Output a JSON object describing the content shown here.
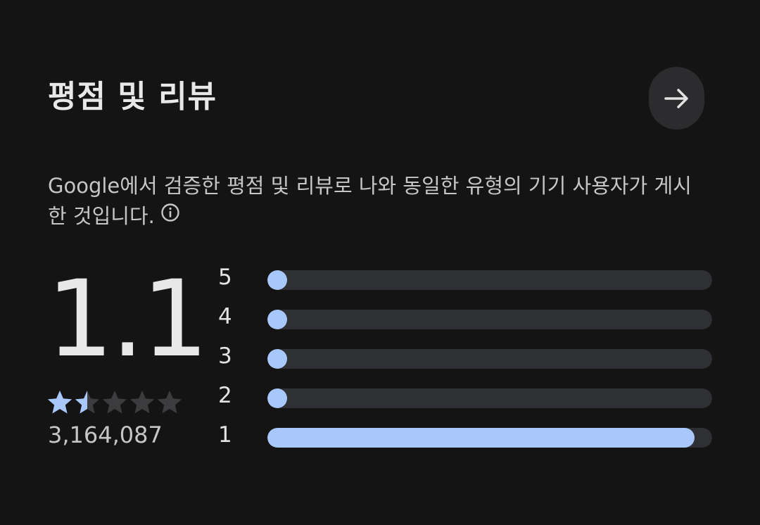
{
  "section": {
    "title": "평점 및 리뷰",
    "description": "Google에서 검증한 평점 및 리뷰로 나와 동일한 유형의 기기 사용자가 게시한 것입니다."
  },
  "rating": {
    "average": "1.1",
    "stars_filled": 1.5,
    "stars_total": 5,
    "review_count": "3,164,087"
  },
  "distribution": [
    {
      "label": "5",
      "fraction": 0.045
    },
    {
      "label": "4",
      "fraction": 0.045
    },
    {
      "label": "3",
      "fraction": 0.045
    },
    {
      "label": "2",
      "fraction": 0.045
    },
    {
      "label": "1",
      "fraction": 0.96
    }
  ],
  "colors": {
    "accent": "#a8c7fa",
    "track": "#2f3033",
    "background": "#141414",
    "star_empty": "#3c3c3e"
  },
  "icons": {
    "arrow": "arrow-right-icon",
    "info": "info-icon",
    "star": "star-icon"
  }
}
